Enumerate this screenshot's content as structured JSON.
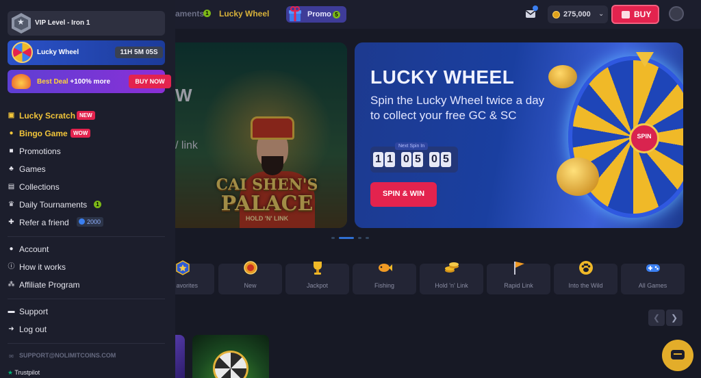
{
  "topbar": {
    "nav_tournaments": "aments",
    "tournaments_count": "1",
    "nav_lucky_wheel": "Lucky Wheel",
    "promo_label": "Promo",
    "promo_count": "5",
    "balance": "275,000",
    "buy_label": "BUY"
  },
  "banner_left": {
    "partial_heading": "W",
    "partial_link": "/ link",
    "game_title_line1": "CAI SHEN'S",
    "game_title_line2": "PALACE",
    "game_subtitle": "HOLD 'N' LINK"
  },
  "banner_right": {
    "title": "LUCKY WHEEL",
    "description": "Spin the Lucky Wheel twice a day to collect your free GC & SC",
    "timer_label": "Next Spin In",
    "timer_digits": [
      "1",
      "1",
      "0",
      "5",
      "0",
      "5"
    ],
    "cta": "SPIN & WIN",
    "wheel_center": "SPIN"
  },
  "categories": [
    {
      "label": "avorites",
      "icon": "star-icon"
    },
    {
      "label": "New",
      "icon": "new-badge-icon"
    },
    {
      "label": "Jackpot",
      "icon": "trophy-icon"
    },
    {
      "label": "Fishing",
      "icon": "fish-icon"
    },
    {
      "label": "Hold 'n' Link",
      "icon": "coins-icon"
    },
    {
      "label": "Rapid Link",
      "icon": "flag-icon"
    },
    {
      "label": "Into the Wild",
      "icon": "paw-icon"
    },
    {
      "label": "All Games",
      "icon": "gamepad-icon"
    }
  ],
  "sidebar": {
    "vip_label": "VIP Level - Iron 1",
    "lucky_wheel_label": "Lucky Wheel",
    "lucky_wheel_timer": "11H 5M 05S",
    "deal_prefix": "Best Deal",
    "deal_suffix": "+100% more",
    "deal_button": "BUY NOW",
    "menu_primary": [
      {
        "label": "Lucky Scratch",
        "tag": "NEW",
        "icon": "scratch-icon"
      },
      {
        "label": "Bingo Game",
        "tag": "WOW",
        "icon": "bingo-icon"
      },
      {
        "label": "Promotions",
        "icon": "gift-icon"
      },
      {
        "label": "Games",
        "icon": "games-icon"
      },
      {
        "label": "Collections",
        "icon": "collections-icon"
      },
      {
        "label": "Daily Tournaments",
        "count": "1",
        "icon": "trophy-icon"
      },
      {
        "label": "Refer a friend",
        "coins": "2000",
        "icon": "add-user-icon"
      }
    ],
    "menu_secondary": [
      {
        "label": "Account",
        "icon": "account-icon"
      },
      {
        "label": "How it works",
        "icon": "info-icon"
      },
      {
        "label": "Affiliate Program",
        "icon": "affiliate-icon"
      }
    ],
    "menu_tertiary": [
      {
        "label": "Support",
        "icon": "chat-icon"
      },
      {
        "label": "Log out",
        "icon": "logout-icon"
      }
    ],
    "support_email": "SUPPORT@NOLIMITCOINS.COM",
    "trustpilot": "Trustpilot"
  },
  "colors": {
    "accent_red": "#e3234e",
    "accent_yellow": "#f2c53a",
    "sidebar_bg": "#1c1e2c",
    "page_bg": "#171925"
  }
}
